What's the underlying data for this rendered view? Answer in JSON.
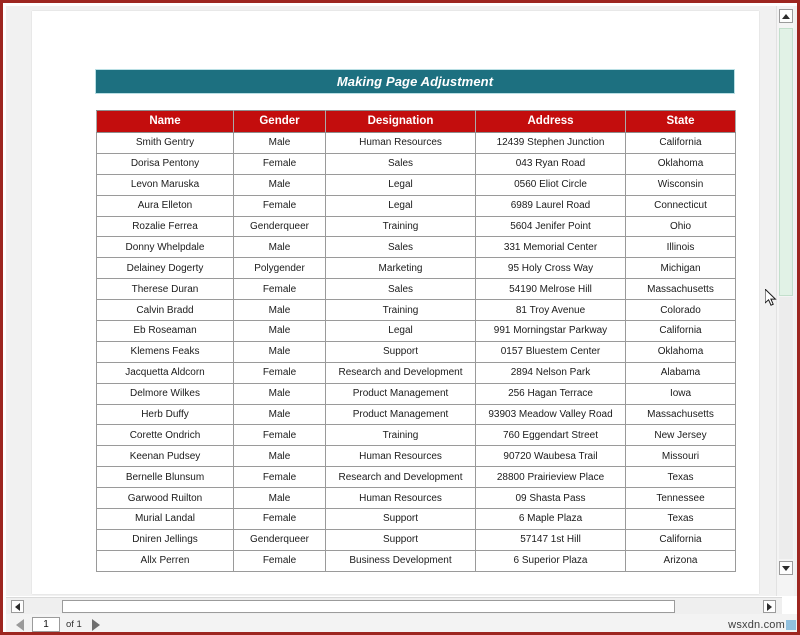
{
  "window": {
    "frame_color": "#9d2620",
    "workspace_color": "#f1f1f1"
  },
  "document": {
    "title": "Making Page Adjustment",
    "title_bar_color": "#1d7080",
    "header_color": "#c30d0d"
  },
  "table": {
    "columns": [
      "Name",
      "Gender",
      "Designation",
      "Address",
      "State"
    ],
    "rows": [
      [
        "Smith Gentry",
        "Male",
        "Human Resources",
        "12439 Stephen Junction",
        "California"
      ],
      [
        "Dorisa Pentony",
        "Female",
        "Sales",
        "043 Ryan Road",
        "Oklahoma"
      ],
      [
        "Levon Maruska",
        "Male",
        "Legal",
        "0560 Eliot Circle",
        "Wisconsin"
      ],
      [
        "Aura Elleton",
        "Female",
        "Legal",
        "6989 Laurel Road",
        "Connecticut"
      ],
      [
        "Rozalie Ferrea",
        "Genderqueer",
        "Training",
        "5604 Jenifer Point",
        "Ohio"
      ],
      [
        "Donny Whelpdale",
        "Male",
        "Sales",
        "331 Memorial Center",
        "Illinois"
      ],
      [
        "Delainey Dogerty",
        "Polygender",
        "Marketing",
        "95 Holy Cross Way",
        "Michigan"
      ],
      [
        "Therese Duran",
        "Female",
        "Sales",
        "54190 Melrose Hill",
        "Massachusetts"
      ],
      [
        "Calvin Bradd",
        "Male",
        "Training",
        "81 Troy Avenue",
        "Colorado"
      ],
      [
        "Eb Roseaman",
        "Male",
        "Legal",
        "991 Morningstar Parkway",
        "California"
      ],
      [
        "Klemens Feaks",
        "Male",
        "Support",
        "0157 Bluestem Center",
        "Oklahoma"
      ],
      [
        "Jacquetta Aldcorn",
        "Female",
        "Research and Development",
        "2894 Nelson Park",
        "Alabama"
      ],
      [
        "Delmore Wilkes",
        "Male",
        "Product Management",
        "256 Hagan Terrace",
        "Iowa"
      ],
      [
        "Herb Duffy",
        "Male",
        "Product Management",
        "93903 Meadow Valley Road",
        "Massachusetts"
      ],
      [
        "Corette Ondrich",
        "Female",
        "Training",
        "760 Eggendart Street",
        "New Jersey"
      ],
      [
        "Keenan Pudsey",
        "Male",
        "Human Resources",
        "90720 Waubesa Trail",
        "Missouri"
      ],
      [
        "Bernelle Blunsum",
        "Female",
        "Research and Development",
        "28800 Prairieview Place",
        "Texas"
      ],
      [
        "Garwood Ruilton",
        "Male",
        "Human Resources",
        "09 Shasta Pass",
        "Tennessee"
      ],
      [
        "Murial Landal",
        "Female",
        "Support",
        "6 Maple Plaza",
        "Texas"
      ],
      [
        "Dniren Jellings",
        "Genderqueer",
        "Support",
        "57147 1st Hill",
        "California"
      ],
      [
        "Allx Perren",
        "Female",
        "Business Development",
        "6 Superior Plaza",
        "Arizona"
      ]
    ]
  },
  "scrollbars": {
    "vertical": {
      "up_icon": "scroll-up-arrow-icon",
      "down_icon": "scroll-down-arrow-icon",
      "thumb_color": "#e1f2e6"
    },
    "horizontal": {
      "left_icon": "scroll-left-arrow-icon",
      "right_icon": "scroll-right-arrow-icon"
    }
  },
  "page_nav": {
    "prev_icon": "previous-page-arrow-icon",
    "next_icon": "next-page-arrow-icon",
    "current_page": "1",
    "total_label": "of 1"
  },
  "watermark": {
    "text": "wsxdn.com"
  }
}
